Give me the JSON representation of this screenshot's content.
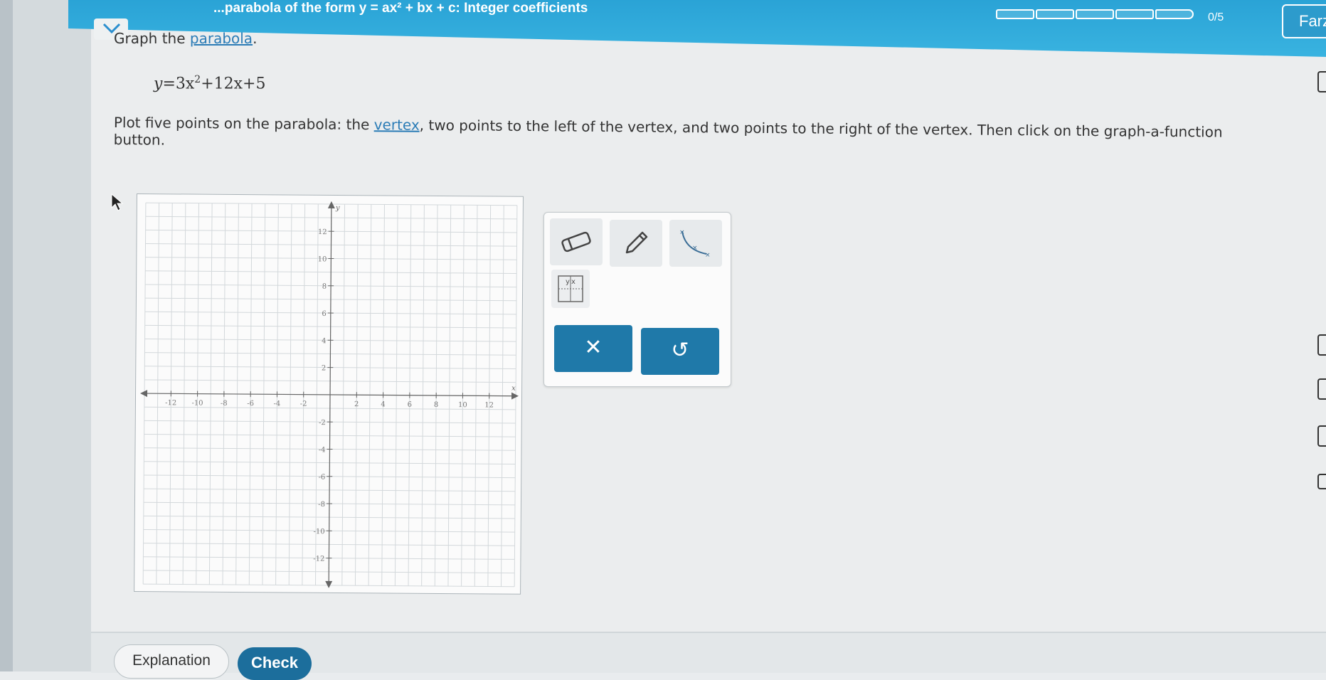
{
  "header": {
    "topic_title": "...parabola of the form y = ax² + bx + c: Integer coefficients",
    "progress_text": "0/5",
    "progress_segments": 5,
    "progress_filled": 0,
    "user_name": "Farz"
  },
  "question": {
    "instruction_prefix": "Graph the",
    "instruction_link": "parabola",
    "instruction_suffix": ".",
    "equation": {
      "lhs": "y",
      "term1": "3x",
      "exponent": "2",
      "rest": "+12x+5"
    },
    "prompt_1": "Plot five points on the parabola: the ",
    "prompt_link": "vertex",
    "prompt_2": ", two points to the left of the vertex, and two points to the right of the vertex. Then click on the graph-a-function button."
  },
  "graph": {
    "x_axis_label": "x",
    "y_axis_label": "y",
    "x_ticks": [
      "-12",
      "-10",
      "-8",
      "-6",
      "-4",
      "-2",
      "2",
      "4",
      "6",
      "8",
      "10",
      "12"
    ],
    "y_ticks": [
      "12",
      "10",
      "8",
      "6",
      "4",
      "2",
      "-2",
      "-4",
      "-6",
      "-8",
      "-10",
      "-12"
    ],
    "range": [
      -14,
      14
    ]
  },
  "tools": {
    "eraser_icon": "eraser-icon",
    "pencil_icon": "pencil-icon",
    "curve_icon": "graph-function-icon",
    "table_icon": "table-icon",
    "clear_label": "✕",
    "undo_label": "↺"
  },
  "footer": {
    "explanation_label": "Explanation",
    "check_label": "Check"
  },
  "colors": {
    "header_blue": "#2aa3d6",
    "button_blue": "#1f79a9",
    "check_blue": "#1c6e9c",
    "link_blue": "#2b7cb6"
  }
}
